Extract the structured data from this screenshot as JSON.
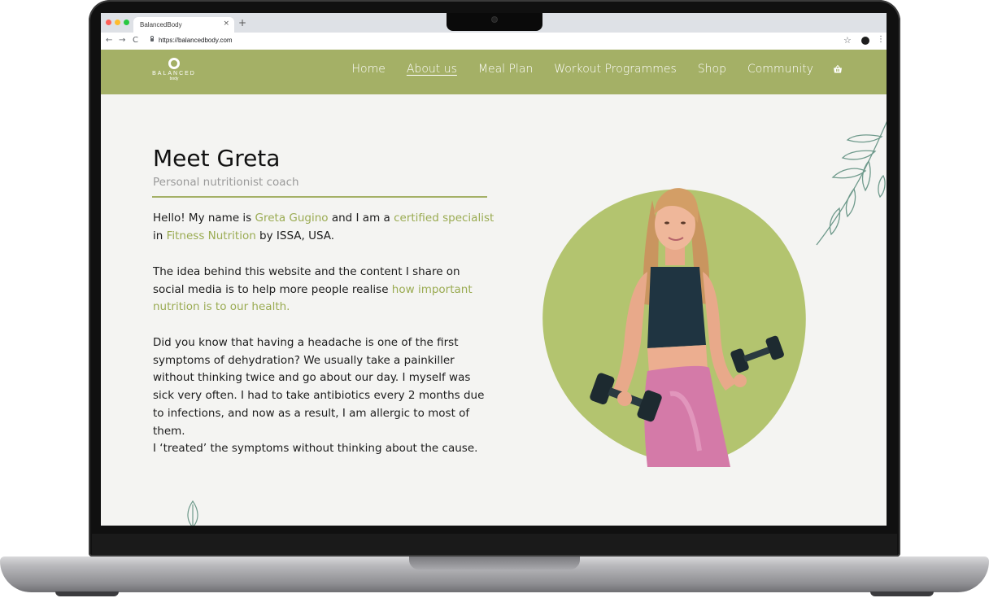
{
  "browser": {
    "tab_title": "BalancedBody",
    "tab_close": "×",
    "new_tab": "+",
    "url": "https://balancedbody.com",
    "back": "←",
    "forward": "→",
    "reload": "C",
    "star": "☆",
    "menu": "⋮"
  },
  "site": {
    "logo": {
      "text": "BALANCED",
      "sub": "body"
    },
    "nav": [
      {
        "label": "Home",
        "active": false
      },
      {
        "label": "About us",
        "active": true
      },
      {
        "label": "Meal Plan",
        "active": false
      },
      {
        "label": "Workout Programmes",
        "active": false
      },
      {
        "label": "Shop",
        "active": false
      },
      {
        "label": "Community",
        "active": false
      }
    ],
    "cart_icon": "basket-icon",
    "accent_color": "#a4b066"
  },
  "about": {
    "title": "Meet Greta",
    "subtitle": "Personal nutritionist coach",
    "p1": {
      "t1": "Hello! My name is ",
      "h1": "Greta Gugino",
      "t2": " and I am a ",
      "h2": "certified specialist",
      "t3": " in ",
      "h3": "Fitness Nutrition",
      "t4": " by ISSA, USA."
    },
    "p2": {
      "t1": "The idea behind this website and the content I share on social media is to help more people realise ",
      "h1": "how important nutrition is to our health."
    },
    "p3": "Did you know that having a headache is one of the first symptoms of dehydration? We usually take a painkiller without thinking twice and go about our day. I myself was sick very often. I had to take antibiotics every 2 months due to infections, and now as a result, I am allergic to most of them.",
    "p4": "I ‘treated’ the symptoms without thinking about the cause."
  }
}
